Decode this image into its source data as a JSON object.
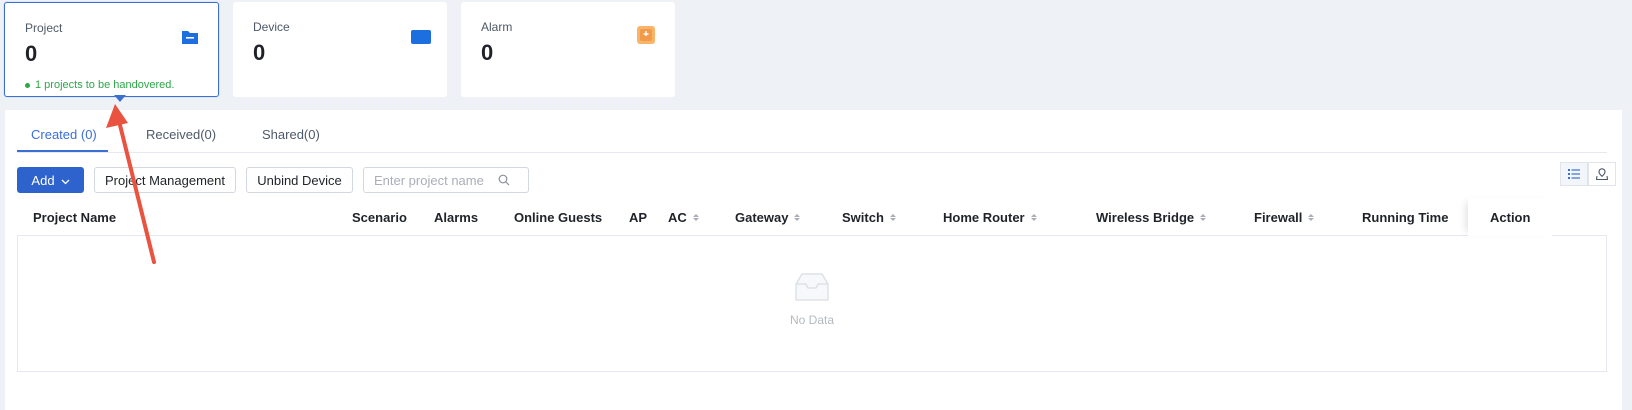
{
  "cards": [
    {
      "title": "Project",
      "value": "0",
      "note": "1 projects to be handovered.",
      "icon": "folder-icon",
      "icon_color": "#1d6fe0"
    },
    {
      "title": "Device",
      "value": "0",
      "icon": "device-icon",
      "icon_color": "#1d6fe0"
    },
    {
      "title": "Alarm",
      "value": "0",
      "icon": "alarm-icon",
      "icon_color": "#f5a04a"
    }
  ],
  "tabs": [
    {
      "label": "Created (0)",
      "active": true
    },
    {
      "label": "Received(0)",
      "active": false
    },
    {
      "label": "Shared(0)",
      "active": false
    }
  ],
  "toolbar": {
    "add_label": "Add",
    "project_management_label": "Project Management",
    "unbind_device_label": "Unbind Device",
    "search_placeholder": "Enter project name"
  },
  "table": {
    "columns": [
      "Project Name",
      "Scenario",
      "Alarms",
      "Online Guests",
      "AP",
      "AC",
      "Gateway",
      "Switch",
      "Home Router",
      "Wireless Bridge",
      "Firewall",
      "Running Time",
      "Action"
    ],
    "empty_text": "No Data"
  },
  "colors": {
    "accent": "#2e63ce",
    "success": "#2ea74a",
    "annotation_arrow": "#e9533f"
  }
}
